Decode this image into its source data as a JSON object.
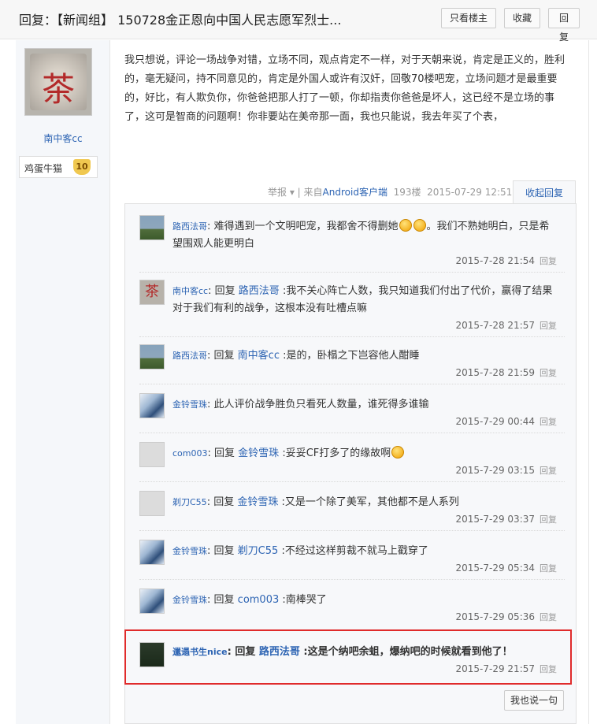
{
  "header": {
    "title": "回复：【新闻组】 150728金正恩向中国人民志愿军烈士...",
    "btn_only_op": "只看楼主",
    "btn_favorite": "收藏",
    "btn_reply": "回复"
  },
  "author": {
    "avatar_char": "茶",
    "name": "南中客cc",
    "badge_text": "鸡蛋牛猫",
    "badge_level": "10"
  },
  "post": {
    "content": "我只想说，评论一场战争对错，立场不同，观点肯定不一样，对于天朝来说，肯定是正义的，胜利的，毫无疑问，持不同意见的，肯定是外国人或许有汉奸，回敬70楼吧宠，立场问题才是最重要的，好比，有人欺负你，你爸爸把那人打了一顿，你却指责你爸爸是坏人，这已经不是立场的事了，这可是智商的问题啊！你非要站在美帝那一面，我也只能说，我去年买了个表，",
    "meta_report": "举报",
    "meta_sep": "▾ | 来自",
    "meta_source": "Android客户端",
    "meta_floor": "193楼",
    "meta_time": "2015-07-29 12:51",
    "collapse_label": "收起回复"
  },
  "replies": [
    {
      "user": "路西法哥",
      "reply_word": "",
      "target": "",
      "text": "难得遇到一个文明吧宠，我都舍不得删她",
      "after": "。我们不熟她明白，只是希望围观人能更明白",
      "time": "2015-7-28 21:54",
      "reply_btn": "回复"
    },
    {
      "user": "南中客cc",
      "reply_word": "回复",
      "target": "路西法哥",
      "text": ":我不关心阵亡人数，我只知道我们付出了代价，赢得了结果对于我们有利的战争，这根本没有吐槽点嘛",
      "after": "",
      "time": "2015-7-28 21:57",
      "reply_btn": "回复"
    },
    {
      "user": "路西法哥",
      "reply_word": "回复",
      "target": "南中客cc",
      "text": ":是的，卧榻之下岂容他人酣睡",
      "after": "",
      "time": "2015-7-28 21:59",
      "reply_btn": "回复"
    },
    {
      "user": "金铃雪珠",
      "reply_word": "",
      "target": "",
      "text": "此人评价战争胜负只看死人数量，谁死得多谁输",
      "after": "",
      "time": "2015-7-29 00:44",
      "reply_btn": "回复"
    },
    {
      "user": "com003",
      "reply_word": "回复",
      "target": "金铃雪珠",
      "text": ":妥妥CF打多了的缘故啊",
      "after": "",
      "time": "2015-7-29 03:15",
      "reply_btn": "回复"
    },
    {
      "user": "剃刀C55",
      "reply_word": "回复",
      "target": "金铃雪珠",
      "text": ":又是一个除了美军，其他都不是人系列",
      "after": "",
      "time": "2015-7-29 03:37",
      "reply_btn": "回复"
    },
    {
      "user": "金铃雪珠",
      "reply_word": "回复",
      "target": "剃刀C55",
      "text": ":不经过这样剪裁不就马上戳穿了",
      "after": "",
      "time": "2015-7-29 05:34",
      "reply_btn": "回复"
    },
    {
      "user": "金铃雪珠",
      "reply_word": "回复",
      "target": "com003",
      "text": ":南棒哭了",
      "after": "",
      "time": "2015-7-29 05:36",
      "reply_btn": "回复"
    },
    {
      "user": "邋遢书生nice",
      "reply_word": "回复",
      "target": "路西法哥",
      "text": ":这是个纳吧余蛆，爆纳吧的时候就看到他了！",
      "after": "",
      "time": "2015-7-29 21:57",
      "reply_btn": "回复"
    }
  ],
  "footer": {
    "say_button": "我也说一句"
  },
  "colors": {
    "link_blue": "#2d64b3",
    "highlight_red": "#e02b2b"
  }
}
